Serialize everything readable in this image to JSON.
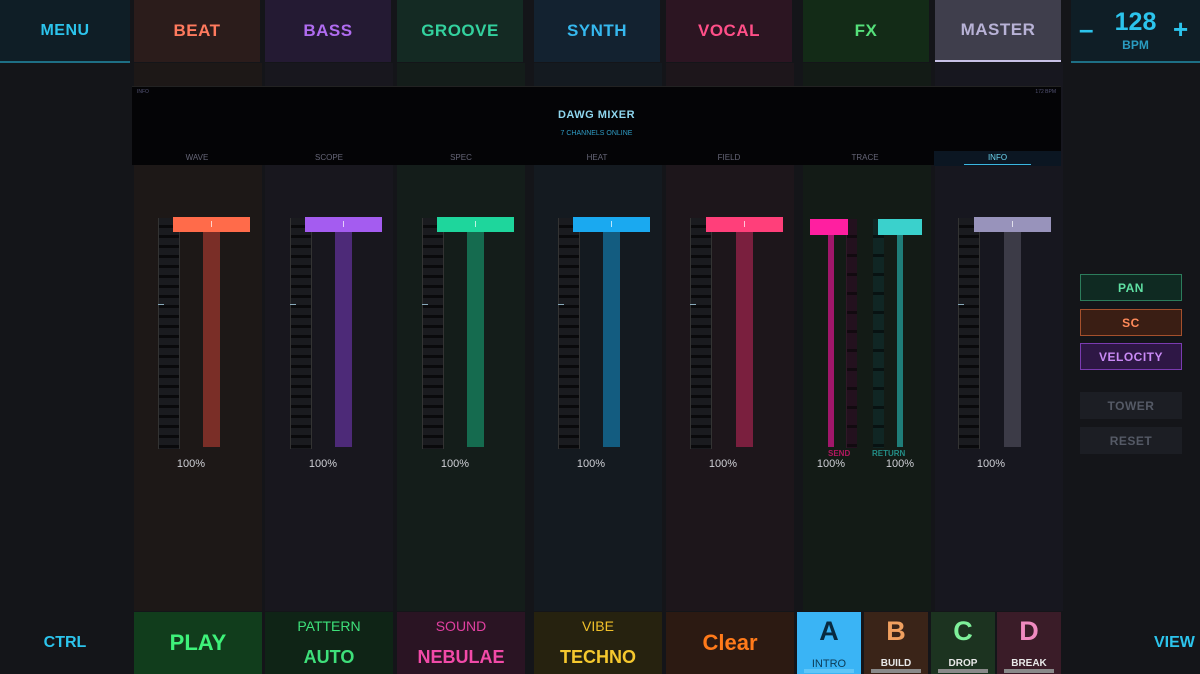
{
  "header": {
    "menu_label": "MENU",
    "tabs": [
      {
        "label": "BEAT",
        "color": "#ff7a5e",
        "bg": "#2b1c1b"
      },
      {
        "label": "BASS",
        "color": "#b06cf0",
        "bg": "#241a33"
      },
      {
        "label": "GROOVE",
        "color": "#33d19e",
        "bg": "#142a23"
      },
      {
        "label": "SYNTH",
        "color": "#36b8ee",
        "bg": "#132230"
      },
      {
        "label": "VOCAL",
        "color": "#ff4f88",
        "bg": "#2c1522"
      },
      {
        "label": "FX",
        "color": "#55e07a",
        "bg": "#132b17"
      },
      {
        "label": "MASTER",
        "color": "#b8b2d6",
        "bg": "#3f3e4c"
      }
    ],
    "bpm": {
      "minus": "–",
      "plus": "+",
      "value": "128",
      "label": "BPM"
    }
  },
  "display": {
    "corner_left": "INFO",
    "corner_right": "172 BPM",
    "title": "DAWG MIXER",
    "subtitle": "7 CHANNELS ONLINE",
    "view_tabs": [
      "WAVE",
      "SCOPE",
      "SPEC",
      "HEAT",
      "FIELD",
      "TRACE",
      "INFO"
    ],
    "active_view": "INFO"
  },
  "mixer": {
    "channels": [
      {
        "name": "beat",
        "level": 100,
        "level_label": "100%",
        "color": "#ff6b4a",
        "track": "#7a2e27"
      },
      {
        "name": "bass",
        "level": 100,
        "level_label": "100%",
        "color": "#a45cf0",
        "track": "#4d2a78"
      },
      {
        "name": "groove",
        "level": 100,
        "level_label": "100%",
        "color": "#1ed69c",
        "track": "#156b4f"
      },
      {
        "name": "synth",
        "level": 100,
        "level_label": "100%",
        "color": "#1aa9f0",
        "track": "#135c80"
      },
      {
        "name": "vocal",
        "level": 100,
        "level_label": "100%",
        "color": "#ff3f7a",
        "track": "#7a1f3e"
      },
      {
        "name": "master",
        "level": 100,
        "level_label": "100%",
        "color": "#9893bb",
        "track": "#3c3b47"
      }
    ],
    "fx": {
      "send_label": "SEND",
      "send_level": 100,
      "send_level_label": "100%",
      "send_color": "#ff1fa0",
      "return_label": "RETURN",
      "return_level": 100,
      "return_level_label": "100%",
      "return_color": "#3ad1cc"
    }
  },
  "side_buttons": [
    {
      "label": "PAN",
      "color": "#5fe0a3",
      "bg": "#0f2a22",
      "border": "#2c7c5b"
    },
    {
      "label": "SC",
      "color": "#ff8a5a",
      "bg": "#3a1e14",
      "border": "#a5502c"
    },
    {
      "label": "VELOCITY",
      "color": "#c98af5",
      "bg": "#2e1745",
      "border": "#7a3bb0"
    },
    {
      "label": "TOWER",
      "color": "#555a66",
      "bg": "#1c1e24",
      "border": "#1c1e24"
    },
    {
      "label": "RESET",
      "color": "#555a66",
      "bg": "#1c1e24",
      "border": "#1c1e24"
    }
  ],
  "footer": {
    "ctrl_label": "CTRL",
    "view_label": "VIEW",
    "play_label": "PLAY",
    "pattern": {
      "label": "PATTERN",
      "value": "AUTO"
    },
    "sound": {
      "label": "SOUND",
      "value": "NEBULAE"
    },
    "vibe": {
      "label": "VIBE",
      "value": "TECHNO"
    },
    "clear_label": "Clear",
    "scenes": [
      {
        "letter": "A",
        "name": "INTRO",
        "active": true
      },
      {
        "letter": "B",
        "name": "BUILD",
        "active": false
      },
      {
        "letter": "C",
        "name": "DROP",
        "active": false
      },
      {
        "letter": "D",
        "name": "BREAK",
        "active": false
      }
    ]
  }
}
